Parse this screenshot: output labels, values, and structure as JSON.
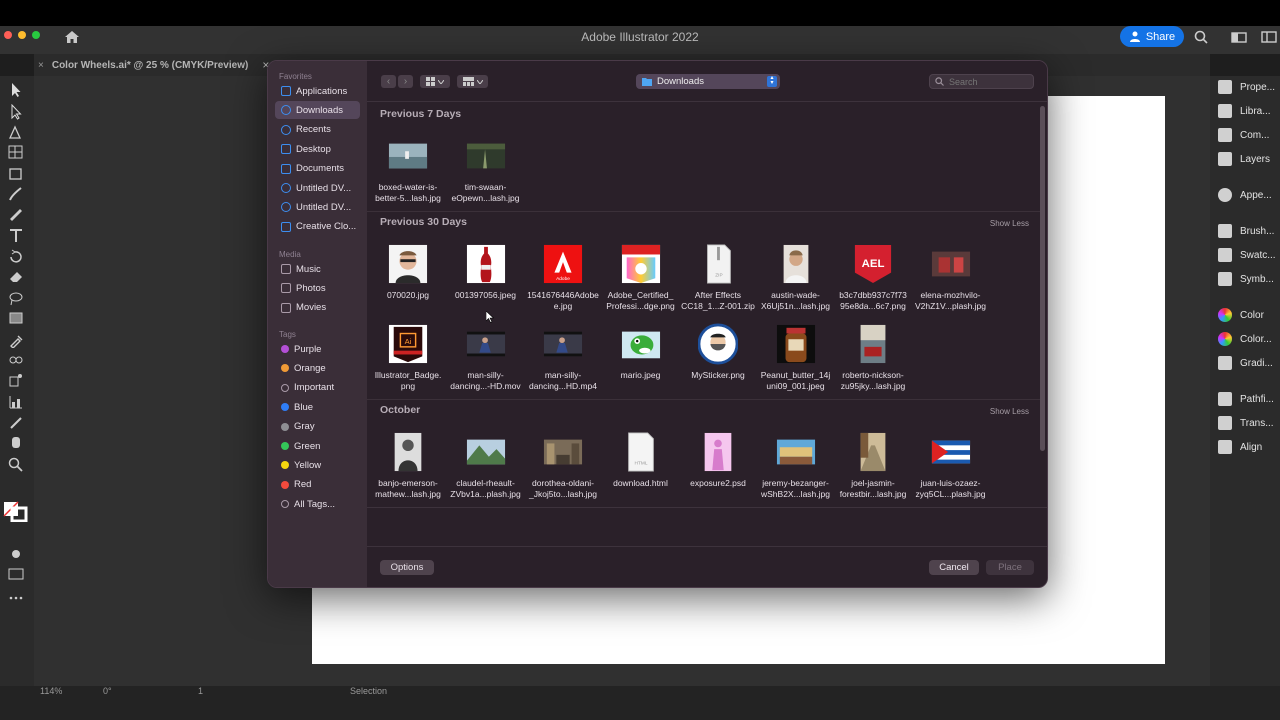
{
  "app": {
    "title": "Adobe Illustrator 2022",
    "share_label": "Share",
    "doc_tab": "Color Wheels.ai* @ 25 % (CMYK/Preview)",
    "close_glyph": "×"
  },
  "right_panel": {
    "items": [
      "Prope...",
      "Libra...",
      "Com...",
      "Layers",
      "Appe...",
      "Brush...",
      "Swatc...",
      "Symb...",
      "Color",
      "Color...",
      "Gradi...",
      "Pathfi...",
      "Trans...",
      "Align"
    ]
  },
  "status_bar": {
    "zoom": "114%",
    "rotation": "0°",
    "artboard": "1",
    "tool": "Selection"
  },
  "dialog": {
    "sidebar": {
      "favorites_header": "Favorites",
      "favorites": [
        "Applications",
        "Downloads",
        "Recents",
        "Desktop",
        "Documents",
        "Untitled DV...",
        "Untitled DV...",
        "Creative Clo..."
      ],
      "media_header": "Media",
      "media": [
        "Music",
        "Photos",
        "Movies"
      ],
      "tags_header": "Tags",
      "tags": [
        {
          "name": "Purple",
          "color": "#b44fd6"
        },
        {
          "name": "Orange",
          "color": "#f09a36"
        },
        {
          "name": "Important",
          "color": ""
        },
        {
          "name": "Blue",
          "color": "#2f7df6"
        },
        {
          "name": "Gray",
          "color": "#8e8e93"
        },
        {
          "name": "Green",
          "color": "#34c759"
        },
        {
          "name": "Yellow",
          "color": "#f5d60e"
        },
        {
          "name": "Red",
          "color": "#f24a3d"
        },
        {
          "name": "All Tags...",
          "color": ""
        }
      ]
    },
    "location": "Downloads",
    "search_placeholder": "Search",
    "sections": [
      {
        "title": "Previous 7 Days",
        "button": "",
        "files": [
          {
            "line1": "boxed-water-is-",
            "line2": "better-5...lash.jpg",
            "thumb": "photo-water"
          },
          {
            "line1": "tim-swaan-",
            "line2": "eOpewn...lash.jpg",
            "thumb": "photo-forest"
          }
        ]
      },
      {
        "title": "Previous 30 Days",
        "button": "Show Less",
        "files": [
          {
            "line1": "070020.jpg",
            "line2": "",
            "thumb": "portrait-glasses"
          },
          {
            "line1": "001397056.jpeg",
            "line2": "",
            "thumb": "coke-bottle"
          },
          {
            "line1": "1541676446Adobe",
            "line2": "e.jpg",
            "thumb": "adobe-logo"
          },
          {
            "line1": "Adobe_Certified_",
            "line2": "Professi...dge.png",
            "thumb": "cert-badge"
          },
          {
            "line1": "After Effects",
            "line2": "CC18_1...Z-001.zip",
            "thumb": "zip-file"
          },
          {
            "line1": "austin-wade-",
            "line2": "X6Uj51n...lash.jpg",
            "thumb": "portrait-man"
          },
          {
            "line1": "b3c7dbb937c7f73",
            "line2": "95e8da...6c7.png",
            "thumb": "ael-badge"
          },
          {
            "line1": "elena-mozhvilo-",
            "line2": "V2hZ1V...plash.jpg",
            "thumb": "photo-red"
          },
          {
            "line1": "Illustrator_Badge.",
            "line2": "png",
            "thumb": "ai-badge"
          },
          {
            "line1": "man-silly-",
            "line2": "dancing...-HD.mov",
            "thumb": "video-dance"
          },
          {
            "line1": "man-silly-",
            "line2": "dancing...HD.mp4",
            "thumb": "video-dance"
          },
          {
            "line1": "mario.jpeg",
            "line2": "",
            "thumb": "yoshi"
          },
          {
            "line1": "MySticker.png",
            "line2": "",
            "thumb": "sticker"
          },
          {
            "line1": "Peanut_butter_14j",
            "line2": "uni09_001.jpeg",
            "thumb": "peanut-jar"
          },
          {
            "line1": "roberto-nickson-",
            "line2": "zu95jky...lash.jpg",
            "thumb": "photo-car"
          }
        ]
      },
      {
        "title": "October",
        "button": "Show Less",
        "files": [
          {
            "line1": "banjo-emerson-",
            "line2": "mathew...lash.jpg",
            "thumb": "photo-bw"
          },
          {
            "line1": "claudel-rheault-",
            "line2": "ZVbv1a...plash.jpg",
            "thumb": "photo-mountain"
          },
          {
            "line1": "dorothea-oldani-",
            "line2": "_Jkoj5to...lash.jpg",
            "thumb": "photo-city"
          },
          {
            "line1": "download.html",
            "line2": "",
            "thumb": "html-file"
          },
          {
            "line1": "exposure2.psd",
            "line2": "",
            "thumb": "psd-pink"
          },
          {
            "line1": "jeremy-bezanger-",
            "line2": "wShB2X...lash.jpg",
            "thumb": "photo-sign"
          },
          {
            "line1": "joel-jasmin-",
            "line2": "forestbir...lash.jpg",
            "thumb": "photo-street"
          },
          {
            "line1": "juan-luis-ozaez-",
            "line2": "zyq5CL...plash.jpg",
            "thumb": "cuba-flag"
          }
        ]
      }
    ],
    "options_label": "Options",
    "cancel_label": "Cancel",
    "place_label": "Place",
    "colors": {
      "accent": "#2f74d8",
      "background": "#2a2029",
      "sidebar": "#3a2e38"
    }
  }
}
